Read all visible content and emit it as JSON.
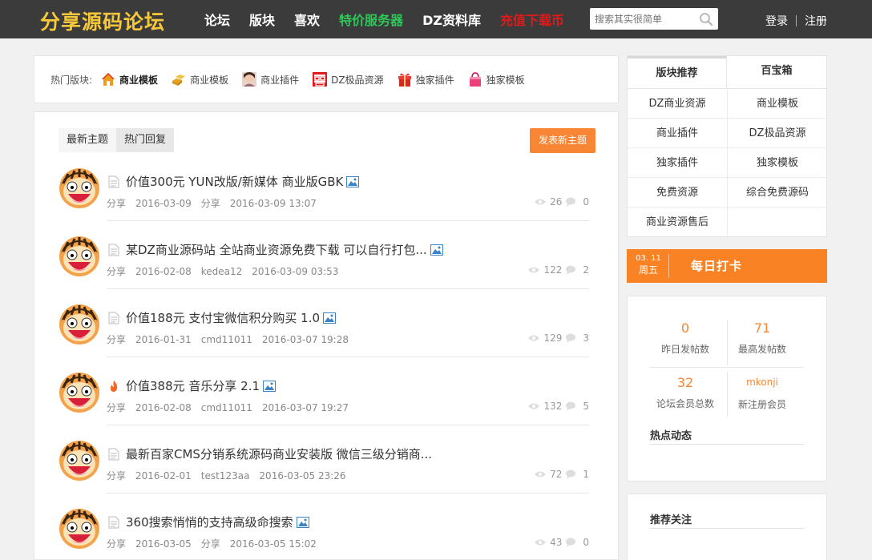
{
  "header": {
    "logo": "分享源码论坛",
    "nav": [
      {
        "label": "论坛",
        "style": "normal"
      },
      {
        "label": "版块",
        "style": "normal"
      },
      {
        "label": "喜欢",
        "style": "normal"
      },
      {
        "label": "特价服务器",
        "style": "green"
      },
      {
        "label": "DZ资料库",
        "style": "normal"
      },
      {
        "label": "充值下载币",
        "style": "red"
      }
    ],
    "search_placeholder": "搜索其实很简单",
    "login": "登录",
    "register": "注册"
  },
  "hot_forums": {
    "label": "热门版块:",
    "items": [
      {
        "label": "商业模板",
        "icon": "house-icon",
        "bold": true
      },
      {
        "label": "商业模板",
        "icon": "gold-bars-icon",
        "bold": false
      },
      {
        "label": "商业插件",
        "icon": "portrait-icon",
        "bold": false
      },
      {
        "label": "DZ极品资源",
        "icon": "double-happiness-icon",
        "bold": false
      },
      {
        "label": "独家插件",
        "icon": "gift-icon",
        "bold": false
      },
      {
        "label": "独家模板",
        "icon": "shopping-bag-icon",
        "bold": false
      }
    ]
  },
  "threads": {
    "tabs": [
      "最新主题",
      "热门回复"
    ],
    "post_button": "发表新主题",
    "items": [
      {
        "title": "价值300元 YUN改版/新媒体 商业版GBK",
        "forum": "分享",
        "date": "2016-03-09",
        "author": "分享",
        "last": "2016-03-09 13:07",
        "views": "26",
        "replies": "0",
        "hot": false,
        "has_image": true
      },
      {
        "title": "某DZ商业源码站 全站商业资源免费下载 可以自行打包...",
        "forum": "分享",
        "date": "2016-02-08",
        "author": "kedea12",
        "last": "2016-03-09 03:53",
        "views": "122",
        "replies": "2",
        "hot": false,
        "has_image": true
      },
      {
        "title": "价值188元 支付宝微信积分购买 1.0",
        "forum": "分享",
        "date": "2016-01-31",
        "author": "cmd11011",
        "last": "2016-03-07 19:28",
        "views": "129",
        "replies": "3",
        "hot": false,
        "has_image": true
      },
      {
        "title": "价值388元 音乐分享 2.1",
        "forum": "分享",
        "date": "2016-02-08",
        "author": "cmd11011",
        "last": "2016-03-07 19:27",
        "views": "132",
        "replies": "5",
        "hot": true,
        "has_image": true
      },
      {
        "title": "最新百家CMS分销系统源码商业安装版 微信三级分销商...",
        "forum": "分享",
        "date": "2016-02-01",
        "author": "test123aa",
        "last": "2016-03-05 23:26",
        "views": "72",
        "replies": "1",
        "hot": false,
        "has_image": false
      },
      {
        "title": "360搜索悄悄的支持高级命搜索",
        "forum": "分享",
        "date": "2016-03-05",
        "author": "分享",
        "last": "2016-03-05 15:02",
        "views": "43",
        "replies": "0",
        "hot": false,
        "has_image": true
      }
    ]
  },
  "recommend": {
    "tabs": [
      "版块推荐",
      "百宝箱"
    ],
    "cells": [
      "DZ商业资源",
      "商业模板",
      "商业插件",
      "DZ极品资源",
      "独家插件",
      "独家模板",
      "免费资源",
      "综合免费源码",
      "商业资源售后",
      ""
    ]
  },
  "checkin": {
    "date": "03. 11",
    "weekday": "周五",
    "label": "每日打卡"
  },
  "forum_stats": {
    "yesterday_posts": {
      "value": "0",
      "label": "昨日发帖数"
    },
    "max_posts": {
      "value": "71",
      "label": "最高发帖数"
    },
    "members": {
      "value": "32",
      "label": "论坛会员总数"
    },
    "newest_member": {
      "value": "mkonji",
      "label": "新注册会员"
    },
    "hot_title": "热点动态"
  },
  "follow": {
    "title": "推荐关注"
  },
  "colors": {
    "header_bg": "#3b3b3b",
    "logo": "#f7c83a",
    "accent": "#f98635",
    "nav_green": "#2fc85a",
    "nav_red": "#e01a1a"
  }
}
